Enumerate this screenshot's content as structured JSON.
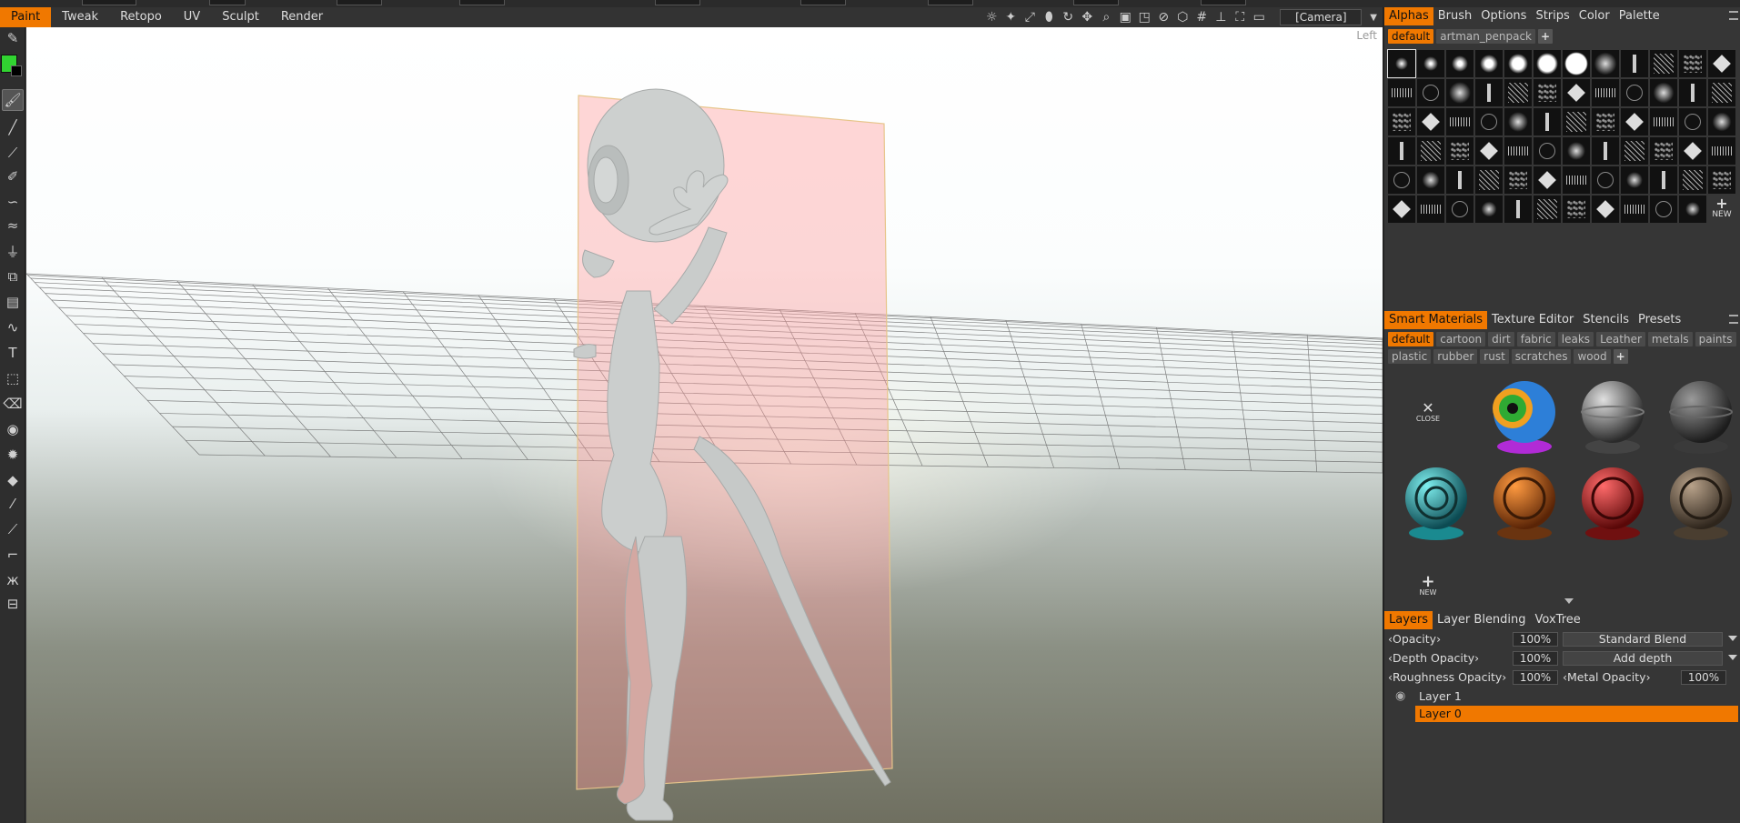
{
  "menubar": {
    "items": [
      "Paint",
      "Tweak",
      "Retopo",
      "UV",
      "Sculpt",
      "Render"
    ],
    "active": "Paint"
  },
  "viewport": {
    "camera": "[Camera]",
    "view_label": "Left"
  },
  "colors": {
    "accent": "#f07800",
    "primary_swatch": "#31d431",
    "secondary_swatch": "#000000"
  },
  "alphas": {
    "tabs": [
      "Alphas",
      "Brush",
      "Options",
      "Strips",
      "Color",
      "Palette"
    ],
    "active_tab": "Alphas",
    "sets": [
      "default",
      "artman_penpack"
    ],
    "active_set": "default",
    "new_label": "NEW"
  },
  "smart_materials": {
    "tabs": [
      "Smart Materials",
      "Texture Editor",
      "Stencils",
      "Presets"
    ],
    "active_tab": "Smart Materials",
    "categories": [
      "default",
      "cartoon",
      "dirt",
      "fabric",
      "leaks",
      "Leather",
      "metals",
      "paints",
      "plastic",
      "rubber",
      "rust",
      "scratches",
      "wood"
    ],
    "active_category": "default",
    "close_label": "CLOSE",
    "new_label": "NEW"
  },
  "layers": {
    "tabs": [
      "Layers",
      "Layer Blending",
      "VoxTree"
    ],
    "active_tab": "Layers",
    "opacity_label": "Opacity",
    "opacity": "100%",
    "blend_mode": "Standard Blend",
    "depth_opacity_label": "Depth Opacity",
    "depth_opacity": "100%",
    "depth_mode": "Add depth",
    "roughness_opacity_label": "Roughness Opacity",
    "roughness_opacity": "100%",
    "metal_opacity_label": "Metal Opacity",
    "metal_opacity": "100%",
    "items": [
      "Layer 1",
      "Layer 0"
    ],
    "active_layer": "Layer 0"
  }
}
